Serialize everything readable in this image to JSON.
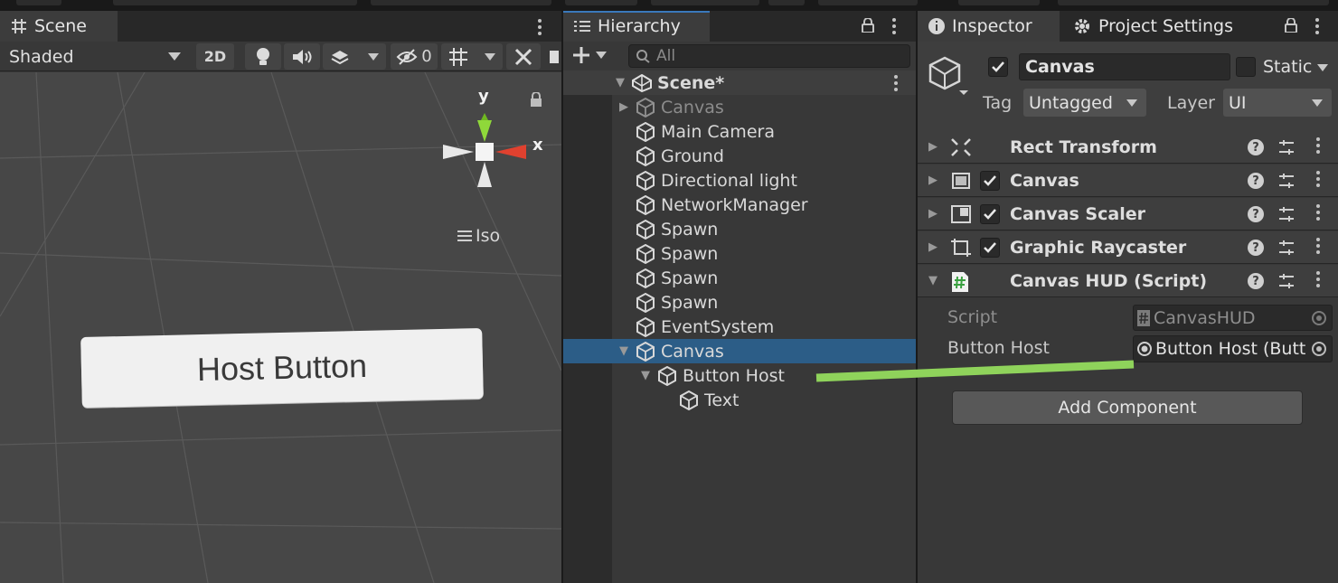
{
  "scene": {
    "tab_label": "Scene",
    "shading_mode": "Shaded",
    "mode_2d": "2D",
    "hidden_count": "0",
    "gizmo_y": "y",
    "gizmo_x": "x",
    "projection": "Iso",
    "host_button_text": "Host Button"
  },
  "hierarchy": {
    "tab_label": "Hierarchy",
    "search_placeholder": "All",
    "scene_name": "Scene*",
    "items": [
      {
        "label": "Canvas"
      },
      {
        "label": "Main Camera"
      },
      {
        "label": "Ground"
      },
      {
        "label": "Directional light"
      },
      {
        "label": "NetworkManager"
      },
      {
        "label": "Spawn"
      },
      {
        "label": "Spawn"
      },
      {
        "label": "Spawn"
      },
      {
        "label": "Spawn"
      },
      {
        "label": "EventSystem"
      },
      {
        "label": "Canvas"
      },
      {
        "label": "Button Host"
      },
      {
        "label": "Text"
      }
    ]
  },
  "inspector": {
    "tab_label": "Inspector",
    "tab2_label": "Project Settings",
    "object_name": "Canvas",
    "static_label": "Static",
    "tag_label": "Tag",
    "tag_value": "Untagged",
    "layer_label": "Layer",
    "layer_value": "UI",
    "components": [
      {
        "name": "Rect Transform"
      },
      {
        "name": "Canvas"
      },
      {
        "name": "Canvas Scaler"
      },
      {
        "name": "Graphic Raycaster"
      },
      {
        "name": "Canvas HUD (Script)"
      }
    ],
    "script_label": "Script",
    "script_value": "CanvasHUD",
    "button_host_label": "Button Host",
    "button_host_value": "Button Host (Butt",
    "add_component_label": "Add Component"
  },
  "colors": {
    "selection": "#2c5d87",
    "annotation": "#8fd35b",
    "accent_tab": "#3a79bb"
  }
}
